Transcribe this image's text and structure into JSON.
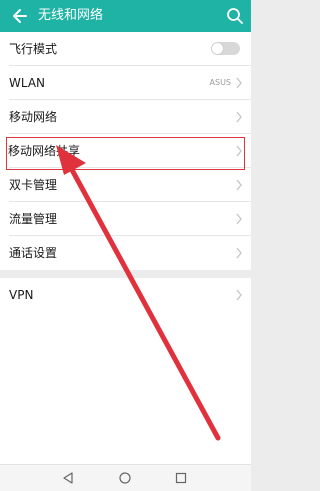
{
  "header": {
    "title": "无线和网络",
    "back_icon": "back-arrow-icon",
    "search_icon": "search-icon",
    "color": "#1fb3a6"
  },
  "settings": {
    "items": [
      {
        "label": "飞行模式",
        "type": "toggle",
        "on": false
      },
      {
        "label": "WLAN",
        "type": "link",
        "value": "ASUS"
      },
      {
        "label": "移动网络",
        "type": "link"
      },
      {
        "label": "移动网络共享",
        "type": "link",
        "highlighted": true
      },
      {
        "label": "双卡管理",
        "type": "link"
      },
      {
        "label": "流量管理",
        "type": "link"
      },
      {
        "label": "通话设置",
        "type": "link"
      }
    ],
    "items2": [
      {
        "label": "VPN",
        "type": "link"
      }
    ]
  },
  "annotation": {
    "color": "#e0323c",
    "points_to": "移动网络共享"
  },
  "navbar": {
    "icons": [
      "back-triangle-icon",
      "home-circle-icon",
      "recents-square-icon"
    ]
  }
}
